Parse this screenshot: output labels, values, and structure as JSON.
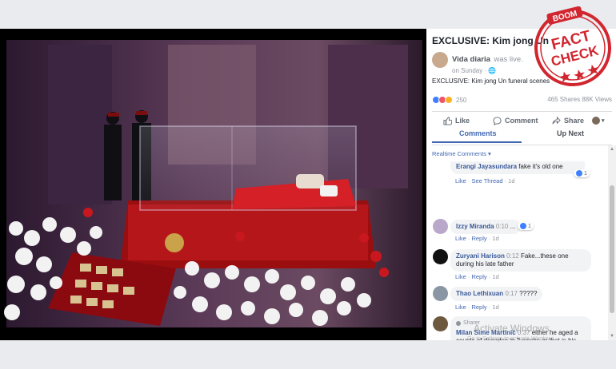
{
  "post": {
    "title": "EXCLUSIVE: Kim jong Un",
    "author": "Vida diaria",
    "was_live": "was live.",
    "time": "on Sunday · 🌐",
    "text": "EXCLUSIVE: Kim jong Un funeral scenes"
  },
  "stats": {
    "reaction_count": "250",
    "shares_views": "465 Shares  88K Views"
  },
  "actions": {
    "like": "Like",
    "comment": "Comment",
    "share": "Share"
  },
  "tabs": {
    "comments": "Comments",
    "up_next": "Up Next"
  },
  "comments_filter": "Realtime Comments ▾",
  "comments": [
    {
      "name": "Erangi Jayasundara",
      "text": "fake it's old one",
      "time": "",
      "meta_like": "Like",
      "meta_rest": "See Thread",
      "age": "1d",
      "reactions": "1"
    },
    {
      "name": "Izzy Miranda",
      "text": "...",
      "time": "0:10",
      "meta_like": "Like",
      "meta_rest": "Reply",
      "age": "1d",
      "reactions": "1"
    },
    {
      "name": "Zuryani Harison",
      "time": "0:12",
      "text": "Fake...these one during his late father",
      "meta_like": "Like",
      "meta_rest": "Reply",
      "age": "1d"
    },
    {
      "name": "Thao Lethixuan",
      "time": "0:17",
      "text": "?????",
      "meta_like": "Like",
      "meta_rest": "Reply",
      "age": "1d"
    },
    {
      "sharer": "Sharer",
      "name": "Milan Sime Martinić",
      "time": "0:37",
      "text": "either he aged a couple of decades in 2 weeks or that is his father there...",
      "meta_like": "Like",
      "meta_rest": "Reply",
      "age": "1d"
    }
  ],
  "watermark": {
    "title": "Activate Windows",
    "subtitle": "Go to Settings to activate Windows."
  },
  "stamp": {
    "brand": "BOOM",
    "line1": "FACT",
    "line2": "CHECK"
  },
  "colors": {
    "fb_blue": "#4267b2",
    "stamp_red": "#d1262f"
  }
}
